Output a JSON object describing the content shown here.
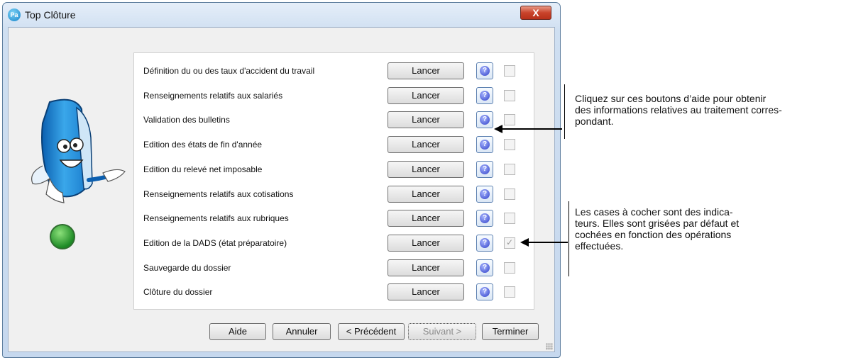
{
  "window": {
    "app_icon_text": "Pa",
    "title": "Top Clôture",
    "close_label": "X"
  },
  "steps": [
    {
      "label": "Définition du ou des taux d'accident du travail",
      "button": "Lancer",
      "checked": false
    },
    {
      "label": "Renseignements relatifs aux salariés",
      "button": "Lancer",
      "checked": false
    },
    {
      "label": "Validation des bulletins",
      "button": "Lancer",
      "checked": false
    },
    {
      "label": "Edition des états de fin d'année",
      "button": "Lancer",
      "checked": false
    },
    {
      "label": "Edition du relevé net imposable",
      "button": "Lancer",
      "checked": false
    },
    {
      "label": "Renseignements relatifs aux cotisations",
      "button": "Lancer",
      "checked": false
    },
    {
      "label": "Renseignements relatifs aux rubriques",
      "button": "Lancer",
      "checked": false
    },
    {
      "label": "Edition de la DADS (état préparatoire)",
      "button": "Lancer",
      "checked": true
    },
    {
      "label": "Sauvegarde du dossier",
      "button": "Lancer",
      "checked": false
    },
    {
      "label": "Clôture du dossier",
      "button": "Lancer",
      "checked": false
    }
  ],
  "footer": {
    "aide": "Aide",
    "annuler": "Annuler",
    "precedent": "< Précédent",
    "suivant": "Suivant >",
    "terminer": "Terminer"
  },
  "callouts": {
    "help_note": "Cliquez sur ces boutons d’aide pour obtenir des informations relatives au traitement corres-pondant.",
    "help_lines": [
      "Cliquez sur ces boutons d’aide pour obtenir",
      "des informations relatives au traitement corres-",
      "pondant."
    ],
    "checkbox_lines": [
      "Les cases à cocher sont des indica-",
      "teurs. Elles sont grisées par défaut et",
      "cochées en fonction des opérations",
      "effectuées."
    ]
  },
  "colors": {
    "window_frame": "#c6d8ee",
    "close_button": "#c9432b",
    "help_icon": "#2f3fc8"
  }
}
